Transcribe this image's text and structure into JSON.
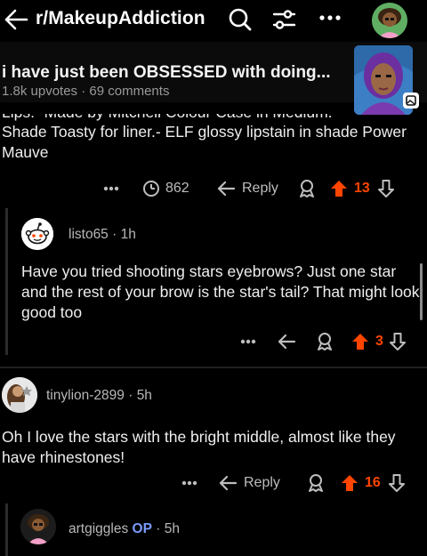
{
  "header": {
    "subreddit": "r/MakeupAddiction",
    "icons": [
      "back-arrow-icon",
      "search-icon",
      "filter-icon",
      "more-icon",
      "user-avatar"
    ]
  },
  "post": {
    "title": "i have just been OBSESSED with doing...",
    "upvotes": "1.8k upvotes",
    "comments": "69 comments"
  },
  "comment1": {
    "clipped_line": "Lips: -Made by Mitchell Colour Case in Medium.",
    "text": "Shade Toasty for liner.- ELF glossy lipstain in shade Power Mauve",
    "views": "862",
    "reply_label": "Reply",
    "votes": "13"
  },
  "reply1": {
    "username": "listo65",
    "time": "1h",
    "text": "Have you tried shooting stars eyebrows?  Just one star and the rest of your brow is the star's tail? That might look good too",
    "votes": "3"
  },
  "comment3": {
    "username": "tinylion-2899",
    "time": "5h",
    "text": "Oh I love the stars with the bright middle, almost  like they have rhinestones!",
    "reply_label": "Reply",
    "votes": "16"
  },
  "comment4": {
    "username": "artgiggles",
    "op_badge": "OP",
    "time": "5h"
  },
  "colors": {
    "background": "#000000",
    "upvote": "#ff4500",
    "op": "#7b9bff",
    "muted": "#9a9a9a"
  }
}
